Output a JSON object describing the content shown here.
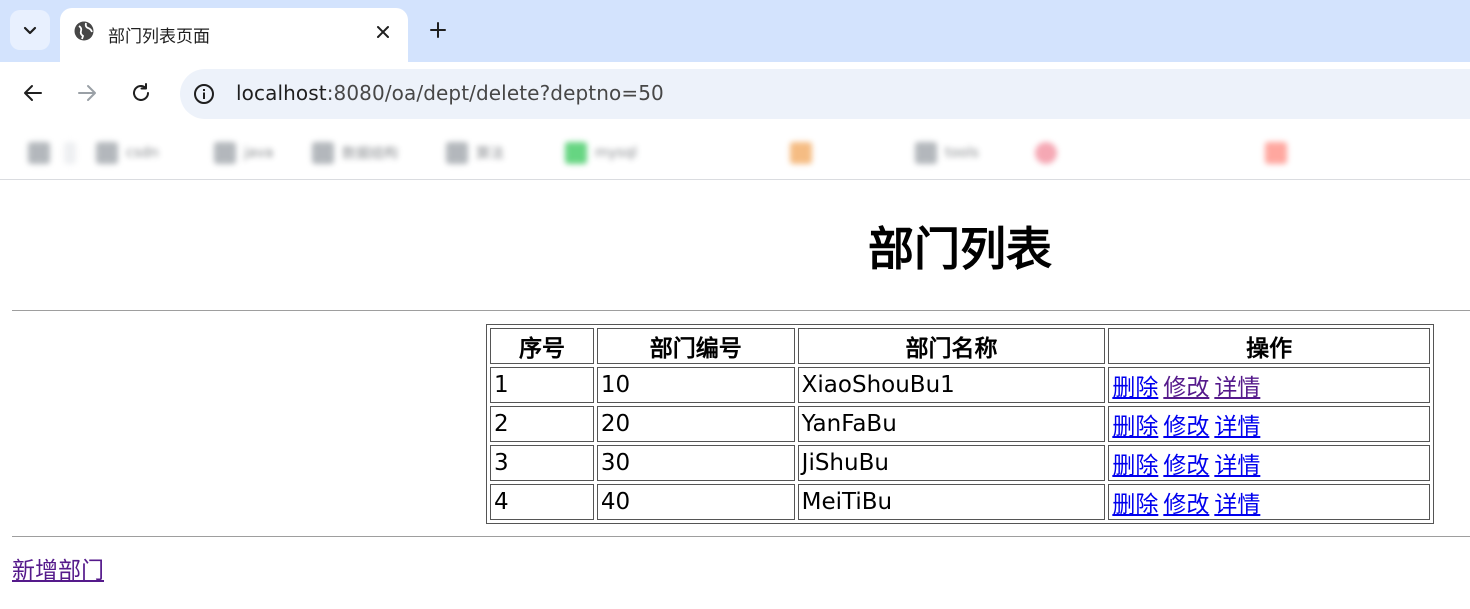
{
  "browser": {
    "tab_title": "部门列表页面",
    "url_host": "localhost",
    "url_path": ":8080/oa/dept/delete?deptno=50",
    "bookmarks": [
      {
        "icon_color": "#9aa0a6",
        "label": ""
      },
      {
        "icon_color": "#e8eaed",
        "label": ""
      },
      {
        "icon_color": "#9aa0a6",
        "label": "csdn"
      },
      {
        "icon_color": "#9aa0a6",
        "label": "java"
      },
      {
        "icon_color": "#9aa0a6",
        "label": "数据结构"
      },
      {
        "icon_color": "#9aa0a6",
        "label": "算法"
      },
      {
        "icon_color": "#34c759",
        "label": "mysql"
      },
      {
        "icon_color": "#f2a65a",
        "label": ""
      },
      {
        "icon_color": "#9aa0a6",
        "label": "tools"
      },
      {
        "icon_color": "#f28b9b",
        "label": ""
      },
      {
        "icon_color": "#ff8a80",
        "label": ""
      }
    ]
  },
  "page": {
    "title": "部门列表",
    "table": {
      "headers": [
        "序号",
        "部门编号",
        "部门名称",
        "操作"
      ],
      "rows": [
        {
          "index": "1",
          "deptno": "10",
          "dname": "XiaoShouBu1"
        },
        {
          "index": "2",
          "deptno": "20",
          "dname": "YanFaBu"
        },
        {
          "index": "3",
          "deptno": "30",
          "dname": "JiShuBu"
        },
        {
          "index": "4",
          "deptno": "40",
          "dname": "MeiTiBu"
        }
      ],
      "actions": {
        "delete": "删除",
        "edit": "修改",
        "detail": "详情"
      }
    },
    "add_link": "新增部门"
  }
}
